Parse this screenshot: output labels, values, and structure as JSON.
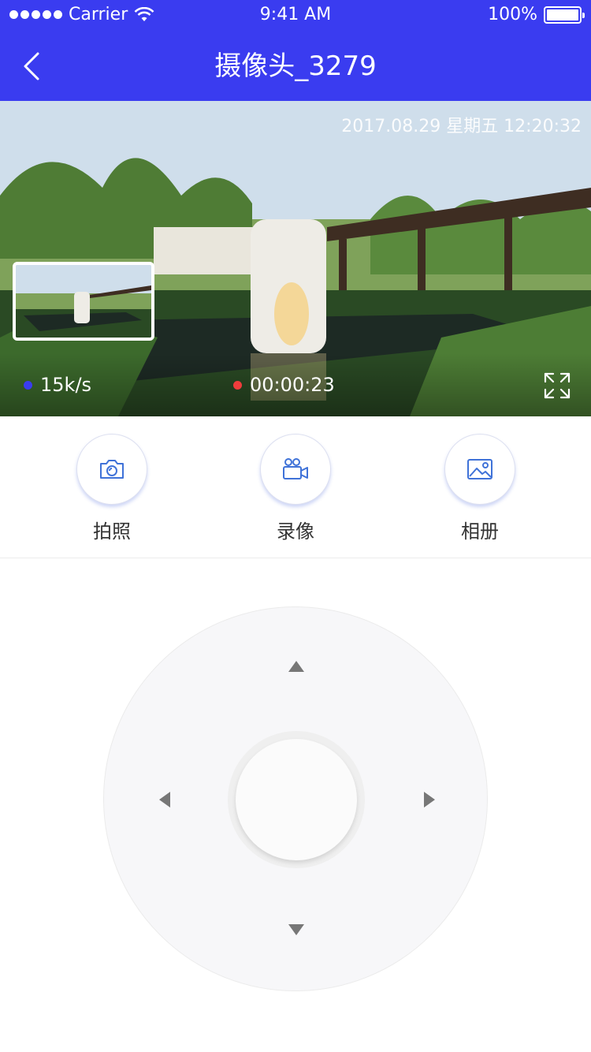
{
  "status_bar": {
    "carrier": "Carrier",
    "time": "9:41 AM",
    "battery": "100%"
  },
  "nav": {
    "title": "摄像头_3279"
  },
  "video": {
    "timestamp": "2017.08.29 星期五 12:20:32",
    "speed": "15k/s",
    "record_time": "00:00:23"
  },
  "actions": [
    {
      "label": "拍照",
      "icon": "camera-icon"
    },
    {
      "label": "录像",
      "icon": "video-camera-icon"
    },
    {
      "label": "相册",
      "icon": "photo-album-icon"
    }
  ],
  "colors": {
    "brand": "#3a3cf0",
    "speed_dot": "#3a3cf0",
    "record_dot": "#f03c3c",
    "icon": "#3f72d8"
  }
}
